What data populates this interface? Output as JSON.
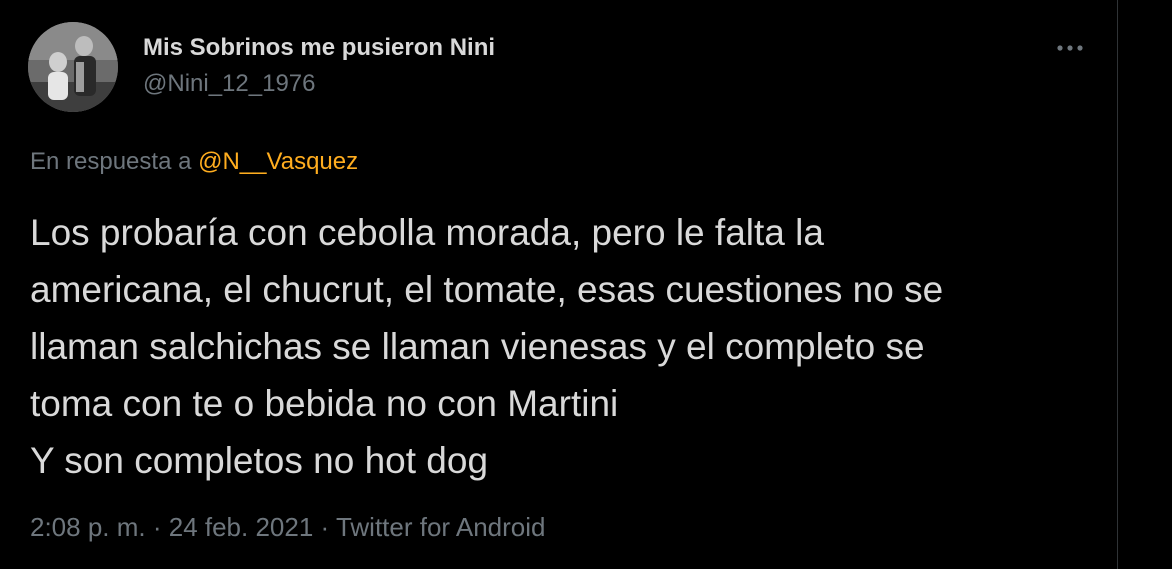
{
  "tweet": {
    "author": {
      "display_name": "Mis Sobrinos me pusieron Nini",
      "handle": "@Nini_12_1976"
    },
    "reply_to": {
      "prefix": "En respuesta a ",
      "mention": "@N__Vasquez"
    },
    "text": "Los probaría con cebolla morada, pero le falta la\namericana, el chucrut,  el tomate, esas cuestiones no se\nllaman salchichas se llaman vienesas y el completo se\ntoma con te o bebida no con Martini\nY son completos no hot dog",
    "time": "2:08 p. m.",
    "separator": " · ",
    "date": "24 feb. 2021",
    "source": "Twitter for Android",
    "more_icon": "more-horizontal-icon"
  },
  "colors": {
    "background": "#000000",
    "text_primary": "#d9d9d9",
    "text_secondary": "#6e767d",
    "accent": "#ffad1f"
  }
}
